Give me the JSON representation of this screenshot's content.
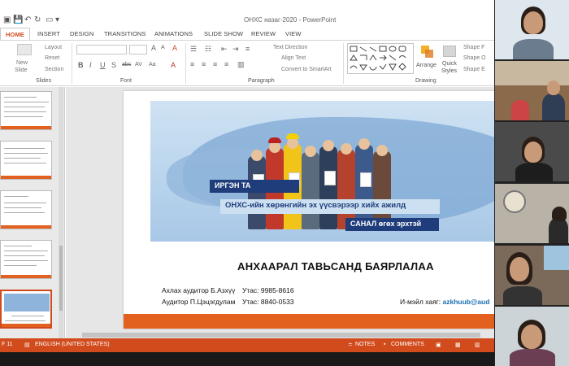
{
  "window": {
    "title": "ОНХС назаг-2020 - PowerPoint"
  },
  "tabs": [
    {
      "label": "HOME",
      "active": true
    },
    {
      "label": "INSERT"
    },
    {
      "label": "DESIGN"
    },
    {
      "label": "TRANSITIONS"
    },
    {
      "label": "ANIMATIONS"
    },
    {
      "label": "SLIDE SHOW"
    },
    {
      "label": "REVIEW"
    },
    {
      "label": "VIEW"
    }
  ],
  "ribbon": {
    "slides": {
      "new_slide": "New",
      "new_slide2": "Slide",
      "layout": "Layout",
      "reset": "Reset",
      "section": "Section",
      "group": "Slides"
    },
    "font": {
      "group": "Font",
      "bold": "B",
      "italic": "I",
      "underline": "U",
      "strike": "S",
      "shadow": "abc",
      "spacing": "AV",
      "case": "Aa"
    },
    "paragraph": {
      "group": "Paragraph",
      "text_direction": "Text Direction",
      "align_text": "Align Text",
      "smartart": "Convert to SmartArt"
    },
    "drawing": {
      "group": "Drawing",
      "arrange": "Arrange",
      "quick_styles": "Quick",
      "quick_styles2": "Styles",
      "shape_fill": "Shape F",
      "shape_outline": "Shape O",
      "shape_effects": "Shape E"
    }
  },
  "slide": {
    "banner": {
      "line1": "ИРГЭН ТА",
      "line2": "ОНХС-ийн хөрөнгийн эх үүсвэрээр хийх ажилд",
      "line3": "САНАЛ өгөх эрхтэй"
    },
    "thanks": "АНХААРАЛ ТАВЬСАНД БАЯРЛАЛАА",
    "contacts": [
      {
        "name": "Ахлах аудитор Б.Азхүү",
        "phone": "Утас: 9985-8616"
      },
      {
        "name": "Аудитор П.Цэцэгдулам",
        "phone": "Утас: 8840-0533"
      }
    ],
    "email_label": "И-мэйл хаяг:",
    "email_value": "azkhuub@aud"
  },
  "status": {
    "slide_counter": "F 11",
    "language": "ENGLISH (UNITED STATES)",
    "notes": "NOTES",
    "comments": "COMMENTS"
  },
  "colors": {
    "accent": "#D14B1D",
    "banner_dark": "#1F3D7A",
    "email_link": "#1A6FB3"
  }
}
